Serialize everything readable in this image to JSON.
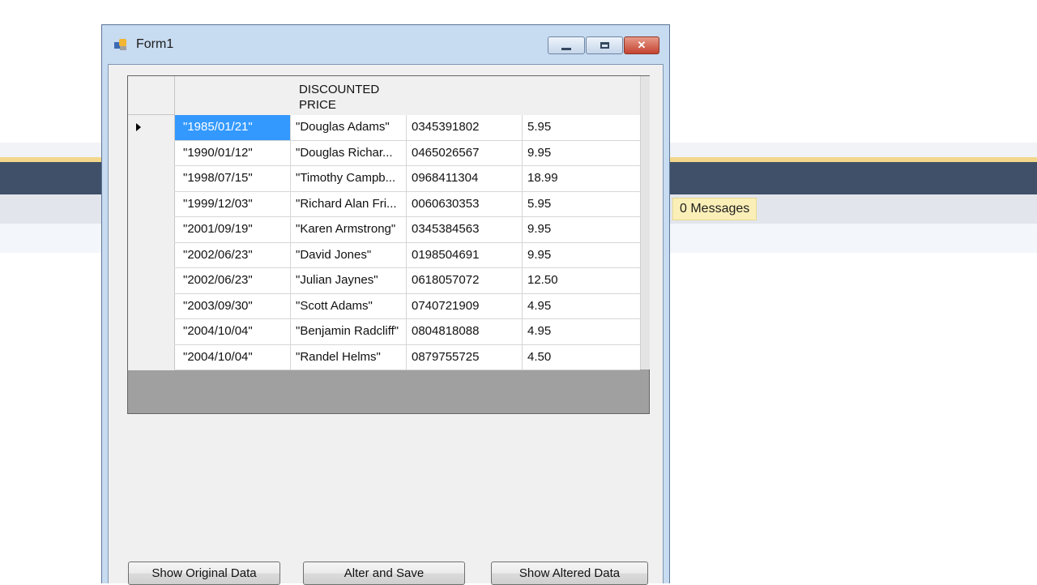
{
  "background": {
    "messages_tab": "0 Messages"
  },
  "window": {
    "title": "Form1",
    "icon": "form-app-icon",
    "caption_buttons": [
      "minimize-icon",
      "maximize-icon",
      "close-icon"
    ]
  },
  "grid": {
    "header": "DISCOUNTED\nPRICE",
    "current_row_indicator": "row-pointer-icon",
    "rows": [
      [
        "\"1985/01/21\"",
        "\"Douglas Adams\"",
        "0345391802",
        "5.95"
      ],
      [
        "\"1990/01/12\"",
        "\"Douglas Richar...",
        "0465026567",
        "9.95"
      ],
      [
        "\"1998/07/15\"",
        "\"Timothy Campb...",
        "0968411304",
        "18.99"
      ],
      [
        "\"1999/12/03\"",
        "\"Richard Alan Fri...",
        "0060630353",
        "5.95"
      ],
      [
        "\"2001/09/19\"",
        "\"Karen Armstrong\"",
        "0345384563",
        "9.95"
      ],
      [
        "\"2002/06/23\"",
        "\"David Jones\"",
        "0198504691",
        "9.95"
      ],
      [
        "\"2002/06/23\"",
        "\"Julian Jaynes\"",
        "0618057072",
        "12.50"
      ],
      [
        "\"2003/09/30\"",
        "\"Scott Adams\"",
        "0740721909",
        "4.95"
      ],
      [
        "\"2004/10/04\"",
        "\"Benjamin Radcliff\"",
        "0804818088",
        "4.95"
      ],
      [
        "\"2004/10/04\"",
        "\"Randel Helms\"",
        "0879755725",
        "4.50"
      ]
    ]
  },
  "buttons": {
    "show_original": "Show Original Data",
    "alter_save": "Alter and Save",
    "show_altered": "Show Altered Data"
  },
  "colors": {
    "selection": "#3399ff",
    "window_frame": "#c7dbf1",
    "ide_band": "#3f5068",
    "messages_tab_bg": "#fbefb8"
  }
}
